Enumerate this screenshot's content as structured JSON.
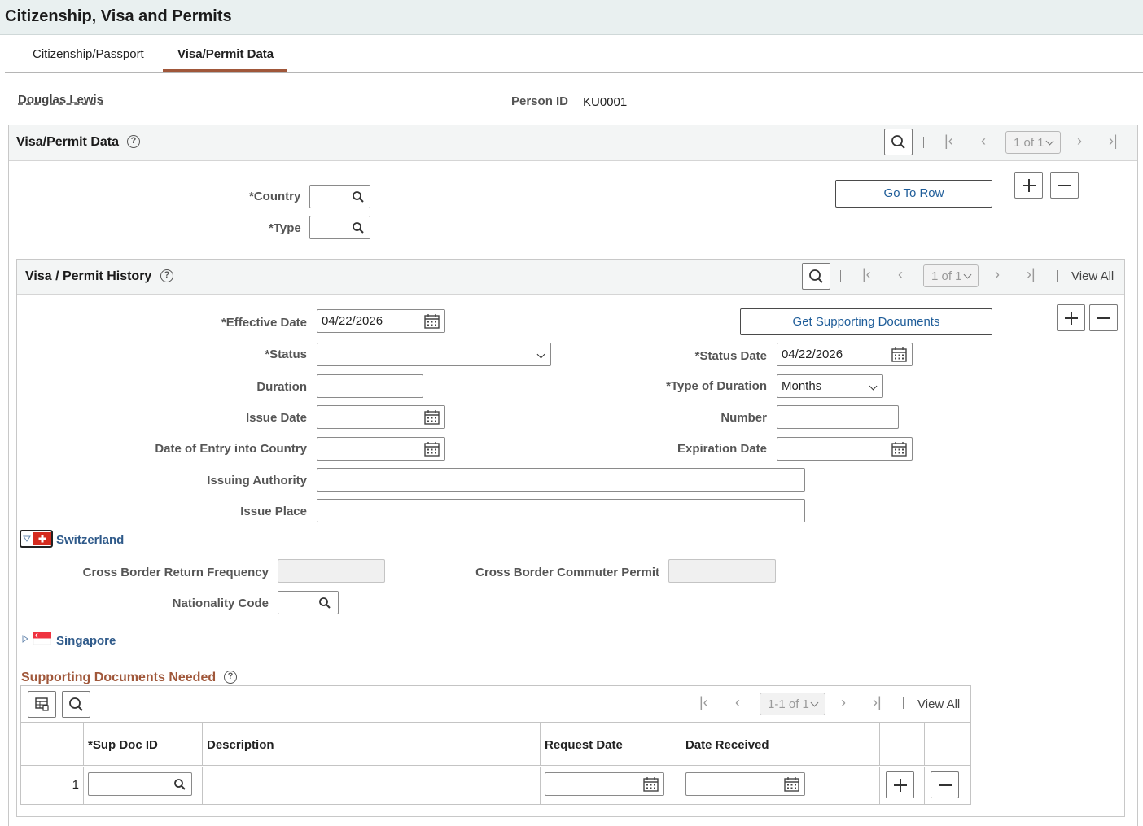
{
  "page": {
    "title": "Citizenship, Visa and Permits"
  },
  "tabs": [
    {
      "label": "Citizenship/Passport",
      "active": false
    },
    {
      "label": "Visa/Permit Data",
      "active": true
    }
  ],
  "person": {
    "name": "Douglas Lewis",
    "id_label": "Person ID",
    "id_value": "KU0001"
  },
  "visa_panel": {
    "title": "Visa/Permit Data",
    "pager": "1 of 1",
    "go_to_row": "Go To Row",
    "country_label": "*Country",
    "type_label": "*Type",
    "country_value": "",
    "type_value": ""
  },
  "history": {
    "title": "Visa / Permit History",
    "pager": "1 of 1",
    "view_all": "View All",
    "get_supporting_docs": "Get Supporting Documents",
    "effective_date_label": "*Effective Date",
    "effective_date": "04/22/2026",
    "status_label": "*Status",
    "status_value": "",
    "status_date_label": "*Status Date",
    "status_date": "04/22/2026",
    "duration_label": "Duration",
    "duration_value": "",
    "type_of_duration_label": "*Type of Duration",
    "type_of_duration": "Months",
    "issue_date_label": "Issue Date",
    "number_label": "Number",
    "date_of_entry_label": "Date of Entry into Country",
    "expiration_date_label": "Expiration Date",
    "issuing_authority_label": "Issuing Authority",
    "issue_place_label": "Issue Place"
  },
  "switzerland": {
    "title": "Switzerland",
    "cross_border_return_label": "Cross Border Return Frequency",
    "cross_border_commuter_label": "Cross Border Commuter Permit",
    "nationality_code_label": "Nationality Code"
  },
  "singapore": {
    "title": "Singapore"
  },
  "supporting_docs": {
    "title": "Supporting Documents Needed",
    "pager": "1-1 of 1",
    "view_all": "View All",
    "columns": [
      "*Sup Doc ID",
      "Description",
      "Request Date",
      "Date Received"
    ],
    "rows": [
      {
        "num": "1",
        "sup_doc_id": "",
        "description": "",
        "request_date": "",
        "date_received": ""
      }
    ]
  },
  "colors": {
    "accent_tab": "#a0573a",
    "link_blue": "#1f5d99",
    "section_brown": "#a0573a"
  }
}
